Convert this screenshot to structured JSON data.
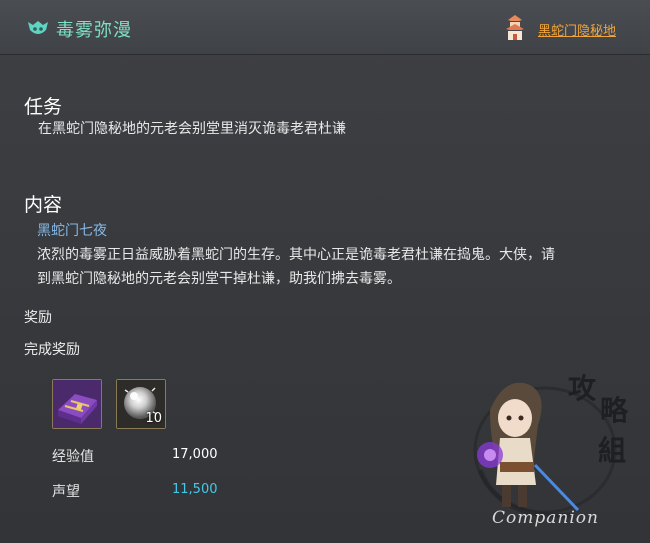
{
  "header": {
    "quest_title": "毒雾弥漫",
    "quest_icon": "quest-mask-icon",
    "location_icon": "location-pagoda-icon",
    "location_link": "黑蛇门隐秘地"
  },
  "task": {
    "heading": "任务",
    "description": "在黑蛇门隐秘地的元老会别堂里消灭诡毒老君杜谦"
  },
  "content": {
    "heading": "内容",
    "subtitle": "黑蛇门七夜",
    "line1": "浓烈的毒雾正日益威胁着黑蛇门的生存。其中心正是诡毒老君杜谦在捣鬼。大侠，请",
    "line2": "到黑蛇门隐秘地的元老会别堂干掉杜谦，助我们拂去毒雾。"
  },
  "rewards": {
    "heading": "奖励",
    "completion_heading": "完成奖励",
    "items": [
      {
        "icon": "purple-chest-icon",
        "count": ""
      },
      {
        "icon": "silver-orb-icon",
        "count": "10"
      }
    ],
    "stats": [
      {
        "label": "经验值",
        "value": "17,000",
        "color": "#ffffff"
      },
      {
        "label": "声望",
        "value": "11,500",
        "color": "#43c8e8"
      }
    ]
  },
  "watermark": {
    "characters": "攻略组",
    "text": "Companion"
  }
}
